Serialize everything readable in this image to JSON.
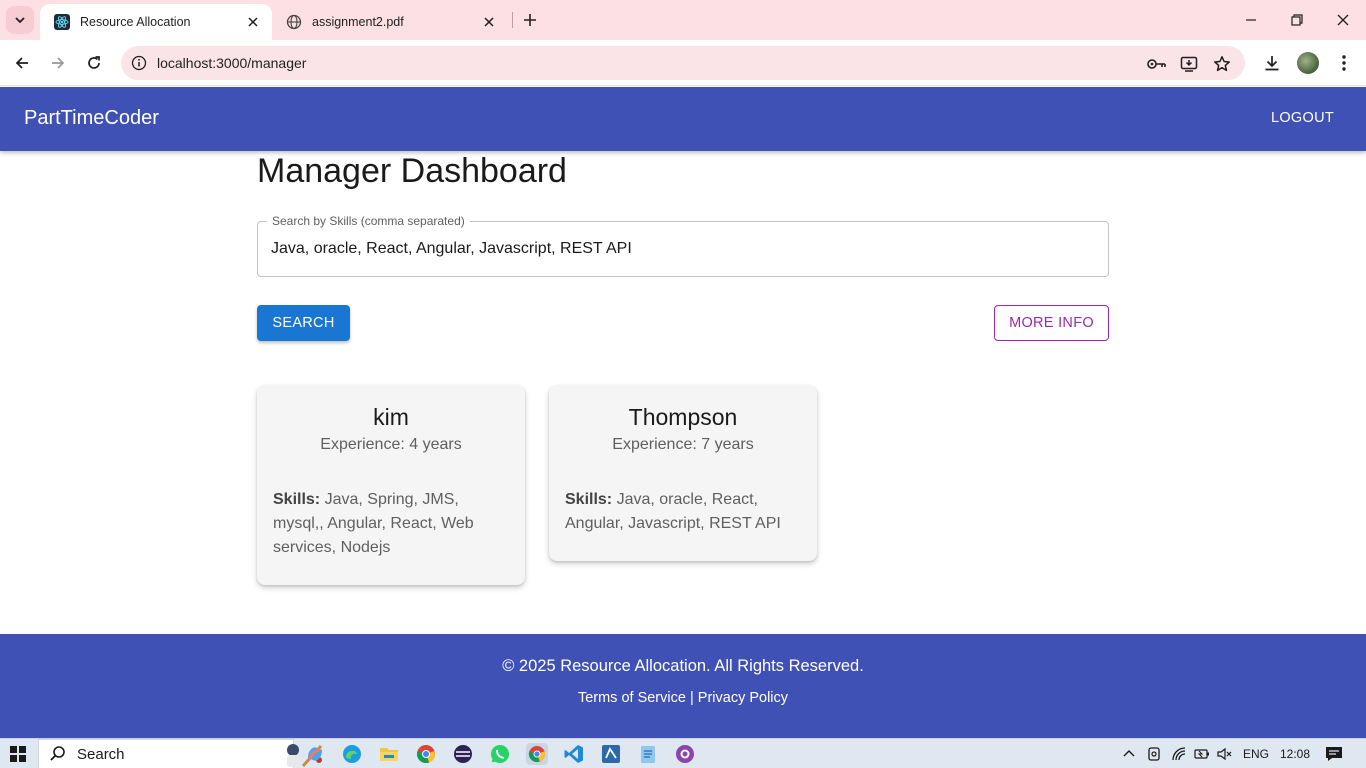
{
  "browser": {
    "tabs": [
      {
        "title": "Resource Allocation",
        "active": true,
        "favicon": "react-icon"
      },
      {
        "title": "assignment2.pdf",
        "active": false,
        "favicon": "globe-icon"
      }
    ],
    "address_bar": {
      "url": "localhost:3000/manager"
    }
  },
  "app": {
    "brand": "PartTimeCoder",
    "logout_label": "LOGOUT",
    "accent_color": "#3f51b5"
  },
  "main": {
    "title": "Manager Dashboard",
    "search": {
      "label": "Search by Skills (comma separated)",
      "value": "Java, oracle, React, Angular, Javascript, REST API"
    },
    "search_button": "SEARCH",
    "more_info_button": "MORE INFO",
    "skills_label": "Skills:",
    "results": [
      {
        "name": "kim",
        "experience": "Experience: 4 years",
        "skills": "Java, Spring, JMS, mysql,, Angular, React, Web services, Nodejs"
      },
      {
        "name": "Thompson",
        "experience": "Experience: 7 years",
        "skills": "Java, oracle, React, Angular, Javascript, REST API"
      }
    ]
  },
  "footer": {
    "copyright": "© 2025 Resource Allocation. All Rights Reserved.",
    "terms": "Terms of Service",
    "separator": "|",
    "privacy": "Privacy Policy"
  },
  "taskbar": {
    "search_label": "Search",
    "language": "ENG",
    "time": "12:08"
  }
}
